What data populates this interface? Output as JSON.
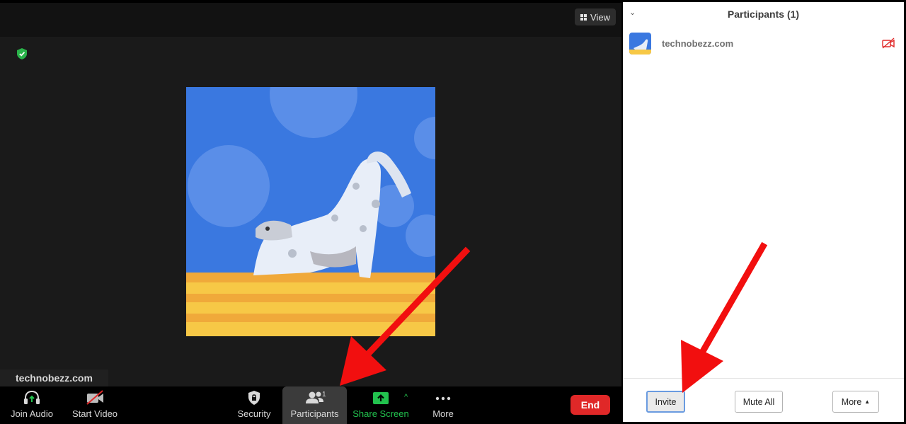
{
  "meeting": {
    "view_label": "View",
    "name_tag": "technobezz.com",
    "colors": {
      "background": "#1a1a1a",
      "toolbar": "#000000",
      "end": "#e02828",
      "share": "#22c24e"
    }
  },
  "toolbar": {
    "join_audio": "Join Audio",
    "start_video": "Start Video",
    "security": "Security",
    "participants": "Participants",
    "participant_count": "1",
    "share_screen": "Share Screen",
    "more": "More",
    "end": "End"
  },
  "panel": {
    "title": "Participants (1)",
    "participants": [
      {
        "name": "technobezz.com",
        "video": "off"
      }
    ],
    "invite": "Invite",
    "mute_all": "Mute All",
    "more": "More"
  }
}
